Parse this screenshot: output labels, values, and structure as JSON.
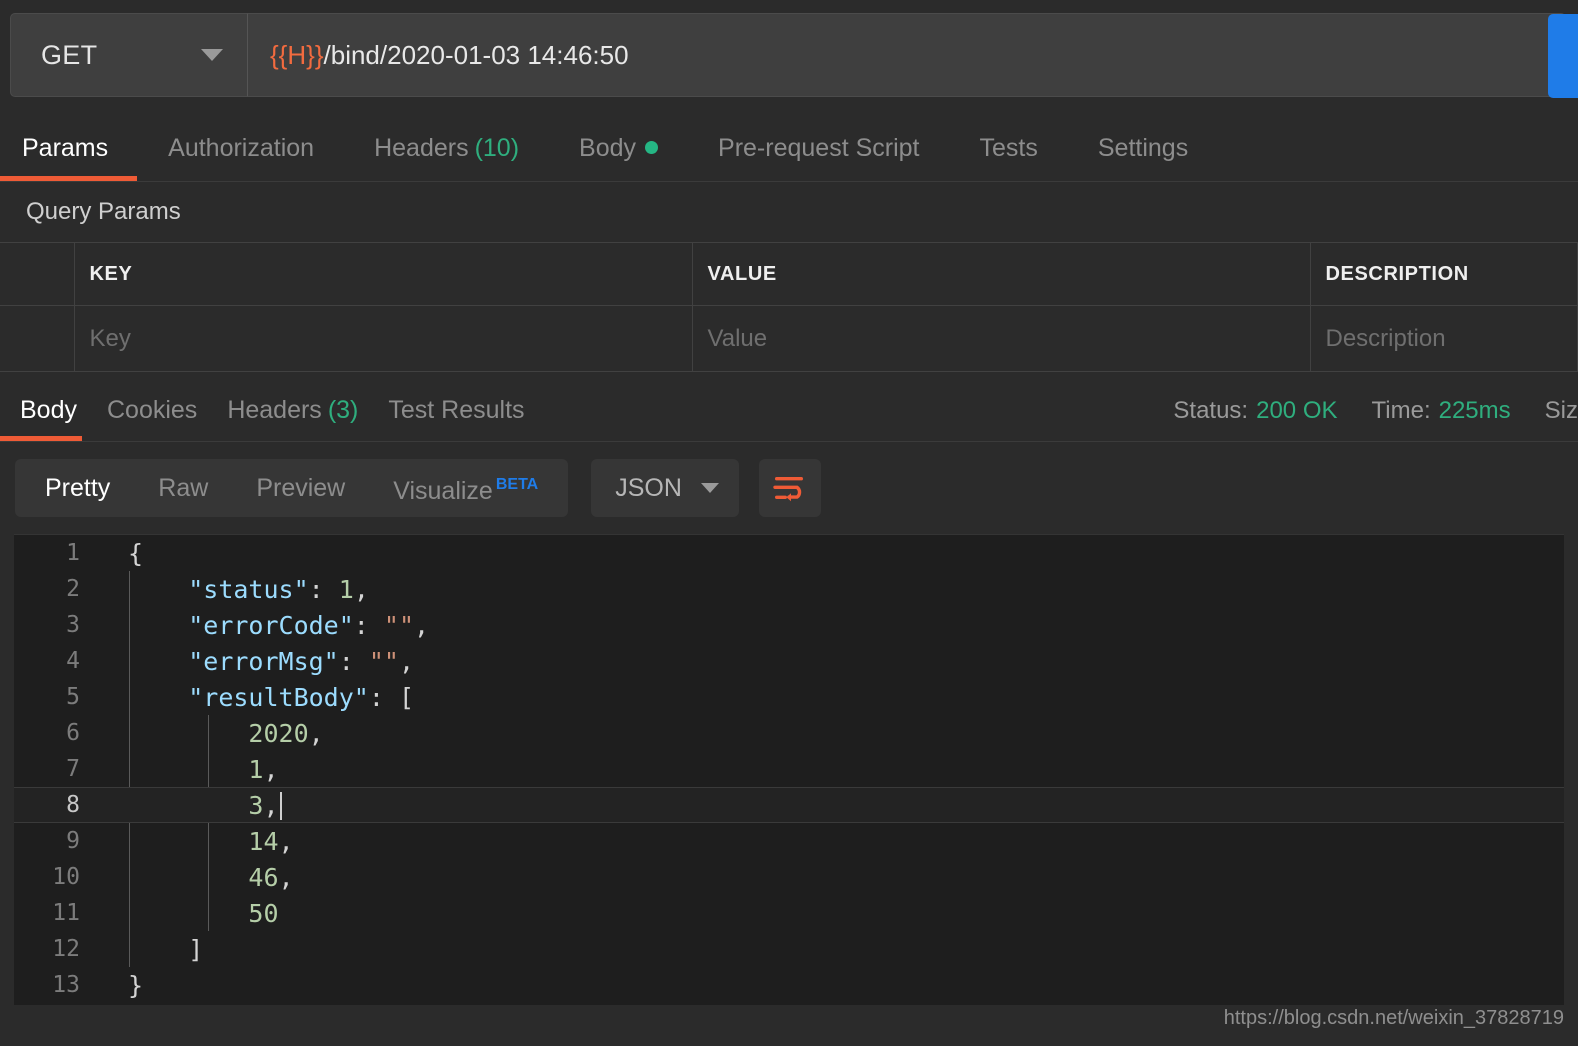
{
  "request": {
    "method": "GET",
    "method_caret_icon": "chevron-down-icon",
    "url_variable": "{{H}}",
    "url_path": "/bind/2020-01-03 14:46:50",
    "send_label": ""
  },
  "request_tabs": [
    {
      "label": "Params",
      "count": "",
      "active": true
    },
    {
      "label": "Authorization",
      "count": "",
      "active": false
    },
    {
      "label": "Headers",
      "count": "(10)",
      "active": false
    },
    {
      "label": "Body",
      "count": "",
      "active": false,
      "dot": true
    },
    {
      "label": "Pre-request Script",
      "count": "",
      "active": false
    },
    {
      "label": "Tests",
      "count": "",
      "active": false
    },
    {
      "label": "Settings",
      "count": "",
      "active": false
    }
  ],
  "query_params": {
    "section_title": "Query Params",
    "headers": [
      "KEY",
      "VALUE",
      "DESCRIPTION"
    ],
    "rows": [
      {
        "key": "Key",
        "value": "Value",
        "description": "Description"
      }
    ]
  },
  "response_tabs": [
    {
      "label": "Body",
      "count": "",
      "active": true
    },
    {
      "label": "Cookies",
      "count": "",
      "active": false
    },
    {
      "label": "Headers",
      "count": "(3)",
      "active": false
    },
    {
      "label": "Test Results",
      "count": "",
      "active": false
    }
  ],
  "response_meta": {
    "status_label": "Status:",
    "status_value": "200 OK",
    "time_label": "Time:",
    "time_value": "225ms",
    "size_label_cut": "Siz"
  },
  "view_toolbar": {
    "segments": [
      {
        "label": "Pretty",
        "active": true
      },
      {
        "label": "Raw",
        "active": false
      },
      {
        "label": "Preview",
        "active": false
      },
      {
        "label": "Visualize",
        "active": false,
        "badge": "BETA"
      }
    ],
    "format_value": "JSON",
    "format_caret_icon": "chevron-down-icon",
    "wrap_icon": "word-wrap-icon"
  },
  "code": {
    "active_line": 8,
    "lines": [
      {
        "n": 1,
        "tokens": [
          {
            "t": "punc",
            "v": "{"
          }
        ]
      },
      {
        "n": 2,
        "tokens": [
          {
            "t": "plain",
            "v": "    "
          },
          {
            "t": "key",
            "v": "\"status\""
          },
          {
            "t": "punc",
            "v": ": "
          },
          {
            "t": "num",
            "v": "1"
          },
          {
            "t": "punc",
            "v": ","
          }
        ]
      },
      {
        "n": 3,
        "tokens": [
          {
            "t": "plain",
            "v": "    "
          },
          {
            "t": "key",
            "v": "\"errorCode\""
          },
          {
            "t": "punc",
            "v": ": "
          },
          {
            "t": "str",
            "v": "\"\""
          },
          {
            "t": "punc",
            "v": ","
          }
        ]
      },
      {
        "n": 4,
        "tokens": [
          {
            "t": "plain",
            "v": "    "
          },
          {
            "t": "key",
            "v": "\"errorMsg\""
          },
          {
            "t": "punc",
            "v": ": "
          },
          {
            "t": "str",
            "v": "\"\""
          },
          {
            "t": "punc",
            "v": ","
          }
        ]
      },
      {
        "n": 5,
        "tokens": [
          {
            "t": "plain",
            "v": "    "
          },
          {
            "t": "key",
            "v": "\"resultBody\""
          },
          {
            "t": "punc",
            "v": ": "
          },
          {
            "t": "punc",
            "v": "["
          }
        ]
      },
      {
        "n": 6,
        "tokens": [
          {
            "t": "plain",
            "v": "        "
          },
          {
            "t": "num",
            "v": "2020"
          },
          {
            "t": "punc",
            "v": ","
          }
        ]
      },
      {
        "n": 7,
        "tokens": [
          {
            "t": "plain",
            "v": "        "
          },
          {
            "t": "num",
            "v": "1"
          },
          {
            "t": "punc",
            "v": ","
          }
        ]
      },
      {
        "n": 8,
        "tokens": [
          {
            "t": "plain",
            "v": "        "
          },
          {
            "t": "num",
            "v": "3"
          },
          {
            "t": "punc",
            "v": ","
          }
        ],
        "caret": true
      },
      {
        "n": 9,
        "tokens": [
          {
            "t": "plain",
            "v": "        "
          },
          {
            "t": "num",
            "v": "14"
          },
          {
            "t": "punc",
            "v": ","
          }
        ]
      },
      {
        "n": 10,
        "tokens": [
          {
            "t": "plain",
            "v": "        "
          },
          {
            "t": "num",
            "v": "46"
          },
          {
            "t": "punc",
            "v": ","
          }
        ]
      },
      {
        "n": 11,
        "tokens": [
          {
            "t": "plain",
            "v": "        "
          },
          {
            "t": "num",
            "v": "50"
          }
        ]
      },
      {
        "n": 12,
        "tokens": [
          {
            "t": "plain",
            "v": "    "
          },
          {
            "t": "punc",
            "v": "]"
          }
        ]
      },
      {
        "n": 13,
        "tokens": [
          {
            "t": "punc",
            "v": "}"
          }
        ]
      }
    ]
  },
  "watermark": "https://blog.csdn.net/weixin_37828719",
  "colors": {
    "accent_orange": "#ef5b36",
    "status_green": "#2fae7e",
    "send_blue": "#1f7ce8",
    "beta_blue": "#1f7ce8",
    "json_key": "#9cdcfe",
    "json_number": "#b5cea8",
    "json_string": "#ce9178",
    "editor_bg": "#1e1e1e",
    "panel_bg": "#2b2b2b"
  }
}
